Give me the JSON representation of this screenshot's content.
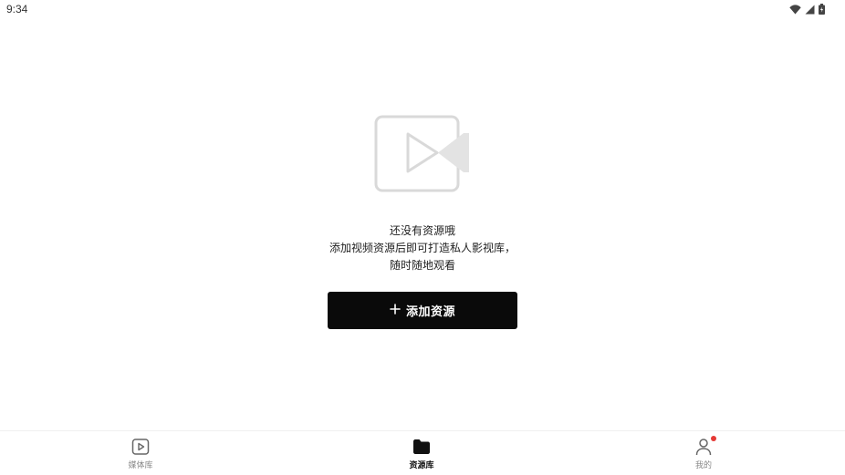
{
  "status_bar": {
    "time": "9:34",
    "icons": [
      "wifi-icon",
      "signal-icon",
      "battery-icon"
    ]
  },
  "empty_state": {
    "icon": "video-camera-icon",
    "title": "还没有资源哦",
    "description_line1": "添加视频资源后即可打造私人影视库，",
    "description_line2": "随时随地观看"
  },
  "add_button": {
    "icon": "plus-icon",
    "label": "添加资源"
  },
  "bottom_nav": {
    "items": [
      {
        "label": "媒体库",
        "icon": "play-square-icon",
        "active": false
      },
      {
        "label": "资源库",
        "icon": "folder-icon",
        "active": true
      },
      {
        "label": "我的",
        "icon": "user-icon",
        "active": false,
        "badge": true
      }
    ]
  },
  "colors": {
    "primary_button": "#0a0a0a",
    "badge": "#e53935",
    "placeholder_icon": "#d9d9d9",
    "inactive_nav": "#888888"
  }
}
